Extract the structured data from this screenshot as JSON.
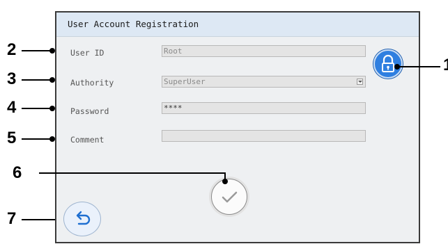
{
  "window": {
    "title": "User Account Registration"
  },
  "form": {
    "user_id": {
      "label": "User ID",
      "value": "Root"
    },
    "authority": {
      "label": "Authority",
      "value": "SuperUser"
    },
    "password": {
      "label": "Password",
      "value": "****"
    },
    "comment": {
      "label": "Comment",
      "value": ""
    }
  },
  "buttons": {
    "lock": {
      "icon": "lock-icon",
      "color": "#2f7fe0"
    },
    "confirm": {
      "icon": "checkmark-icon"
    },
    "back": {
      "icon": "undo-arrow-icon"
    }
  },
  "callouts": [
    "1",
    "2",
    "3",
    "4",
    "5",
    "6",
    "7"
  ]
}
